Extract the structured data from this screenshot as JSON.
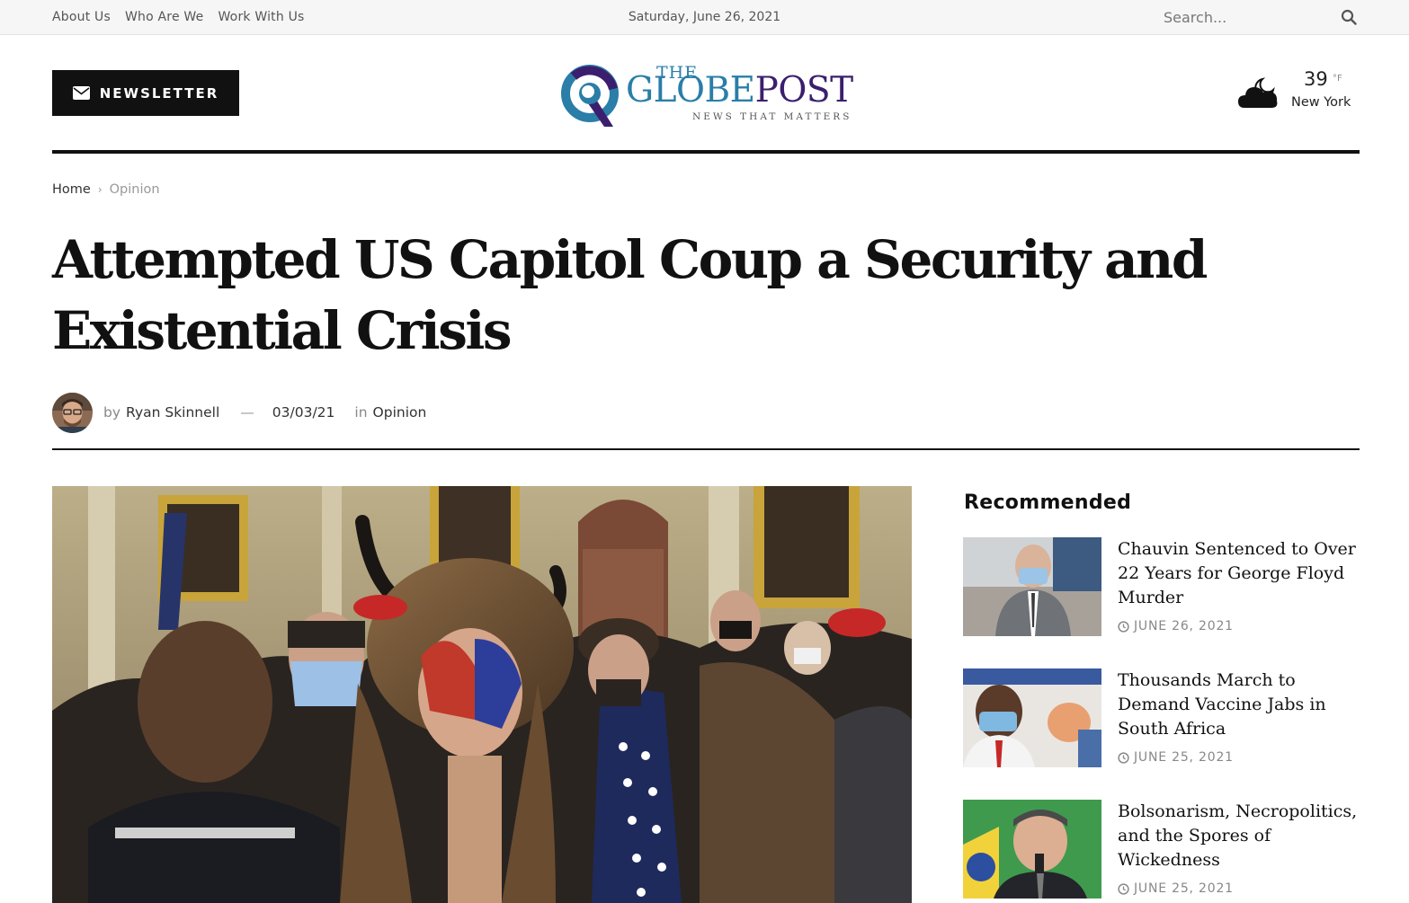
{
  "topbar": {
    "nav": [
      "About Us",
      "Who Are We",
      "Work With Us"
    ],
    "date": "Saturday, June 26, 2021",
    "search_placeholder": "Search..."
  },
  "header": {
    "newsletter_label": "NEWSLETTER",
    "logo": {
      "the": "THE",
      "globe": "GLOBE",
      "post": "POST",
      "tagline": "NEWS THAT MATTERS"
    },
    "weather": {
      "temp": "39",
      "unit": "°F",
      "city": "New York",
      "icon": "cloud-moon-icon"
    }
  },
  "breadcrumb": {
    "home": "Home",
    "current": "Opinion"
  },
  "article": {
    "title": "Attempted US Capitol Coup a Security and Existential Crisis",
    "by_label": "by",
    "author": "Ryan Skinnell",
    "dash": "—",
    "date": "03/03/21",
    "in_label": "in",
    "category": "Opinion"
  },
  "sidebar": {
    "title": "Recommended",
    "items": [
      {
        "headline": "Chauvin Sentenced to Over 22 Years for George Floyd Murder",
        "date": "JUNE 26, 2021"
      },
      {
        "headline": "Thousands March to Demand Vaccine Jabs in South Africa",
        "date": "JUNE 25, 2021"
      },
      {
        "headline": "Bolsonarism, Necropolitics, and the Spores of Wickedness",
        "date": "JUNE 25, 2021"
      }
    ]
  },
  "colors": {
    "brand_blue": "#2a7ea8",
    "brand_purple": "#3b1f6e",
    "dark": "#111111"
  }
}
